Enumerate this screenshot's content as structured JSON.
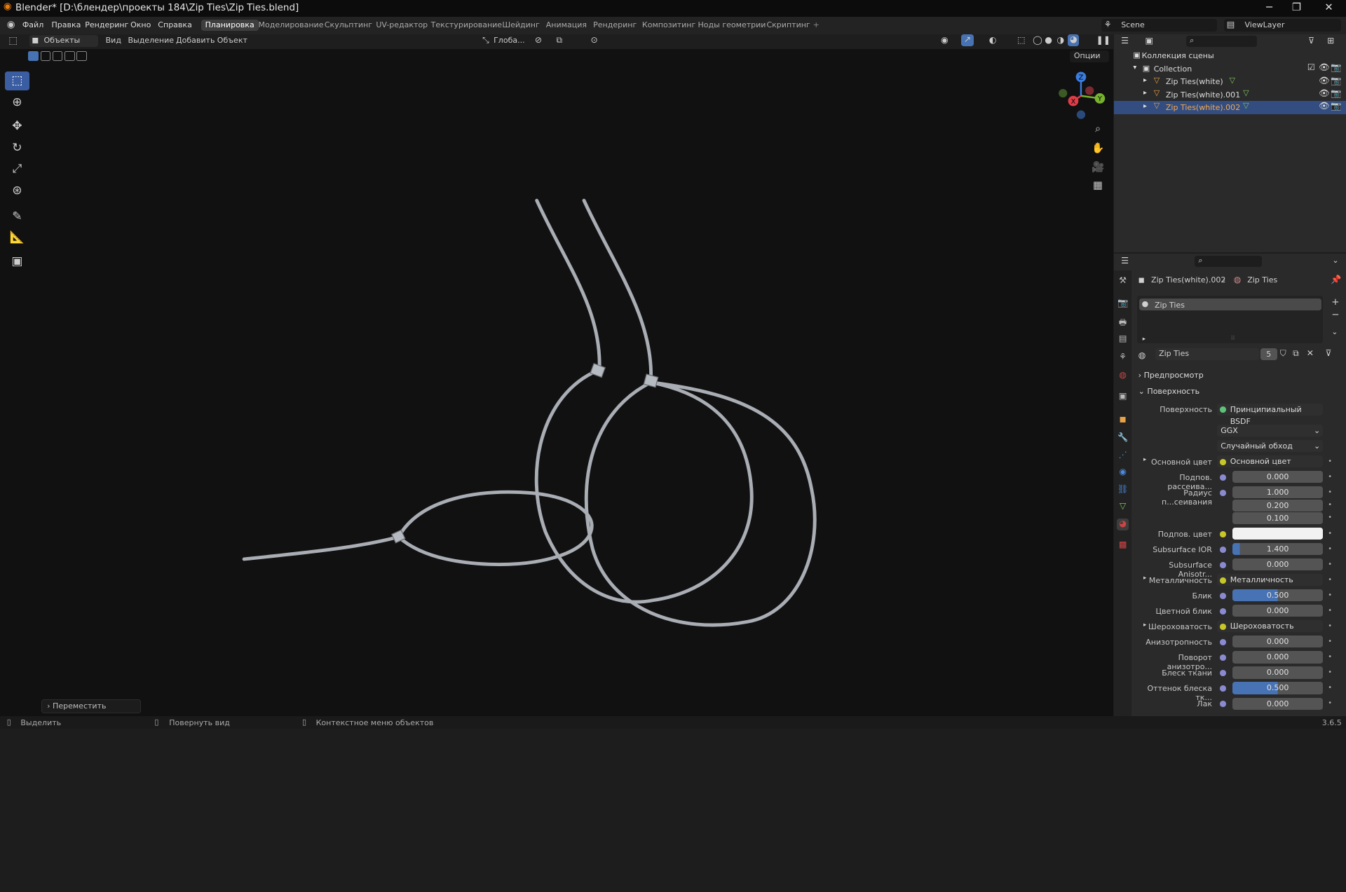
{
  "window": {
    "title": "Blender* [D:\\блендер\\проекты 184\\Zip Ties\\Zip Ties.blend]",
    "min": "─",
    "max": "❐",
    "close": "✕"
  },
  "menus": [
    "Файл",
    "Правка",
    "Рендеринг",
    "Окно",
    "Справка"
  ],
  "workspaces": [
    "Планировка",
    "Моделирование",
    "Скульптинг",
    "UV-редактор",
    "Текстурирование",
    "Шейдинг",
    "Анимация",
    "Рендеринг",
    "Композитинг",
    "Ноды геометрии",
    "Скриптинг",
    "+"
  ],
  "scene": {
    "name": "Scene",
    "view_layer": "ViewLayer"
  },
  "viewport_header": {
    "mode": "Объекты",
    "view": "Вид",
    "select": "Выделение",
    "add": "Добавить",
    "object": "Объект",
    "orientation": "Глоба...",
    "options": "Опции"
  },
  "gizmo": {
    "x": "X",
    "y": "Y",
    "z": "Z"
  },
  "toolbar": [
    "select-box",
    "cursor",
    "move",
    "rotate",
    "scale",
    "transform",
    "annotate",
    "measure",
    "add-cube"
  ],
  "operator_panel": "Переместить",
  "status": {
    "left": "Выделить",
    "middle": "Повернуть вид",
    "right": "Контекстное меню объектов",
    "version": "3.6.5"
  },
  "outliner": {
    "scene_collection": "Коллекция сцены",
    "collection": "Collection",
    "objects": [
      "Zip Ties(white)",
      "Zip Ties(white).001",
      "Zip Ties(white).002"
    ],
    "selected_index": 2
  },
  "properties": {
    "breadcrumb_object": "Zip Ties(white).002",
    "breadcrumb_material": "Zip Ties",
    "slot": "Zip Ties",
    "material_name": "Zip Ties",
    "users": "5",
    "preview_label": "Предпросмотр",
    "surface_section": "Поверхность",
    "surface_label": "Поверхность",
    "surface_value": "Принципиальный BSDF",
    "distribution": "GGX",
    "subsurface_method": "Случайный обход",
    "rows": [
      {
        "label": "Основной цвет",
        "value": "Основной цвет",
        "kind": "link"
      },
      {
        "label": "Подпов. рассеива...",
        "value": "0.000",
        "kind": "num"
      },
      {
        "label": "Радиус п...сеивания",
        "value": "1.000",
        "kind": "num"
      },
      {
        "label": "",
        "value": "0.200",
        "kind": "num"
      },
      {
        "label": "",
        "value": "0.100",
        "kind": "num"
      },
      {
        "label": "Подпов. цвет",
        "value": "",
        "kind": "color"
      },
      {
        "label": "Subsurface IOR",
        "value": "1.400",
        "kind": "num",
        "fill": 0.08
      },
      {
        "label": "Subsurface Anisotr...",
        "value": "0.000",
        "kind": "num"
      },
      {
        "label": "Металличность",
        "value": "Металличность",
        "kind": "link"
      },
      {
        "label": "Блик",
        "value": "0.500",
        "kind": "num",
        "fill": 0.5
      },
      {
        "label": "Цветной блик",
        "value": "0.000",
        "kind": "num"
      },
      {
        "label": "Шероховатость",
        "value": "Шероховатость",
        "kind": "link"
      },
      {
        "label": "Анизотропность",
        "value": "0.000",
        "kind": "num"
      },
      {
        "label": "Поворот анизотро...",
        "value": "0.000",
        "kind": "num"
      },
      {
        "label": "Блеск ткани",
        "value": "0.000",
        "kind": "num"
      },
      {
        "label": "Оттенок блеска тк...",
        "value": "0.500",
        "kind": "num",
        "fill": 0.5
      },
      {
        "label": "Лак",
        "value": "0.000",
        "kind": "num"
      }
    ]
  }
}
